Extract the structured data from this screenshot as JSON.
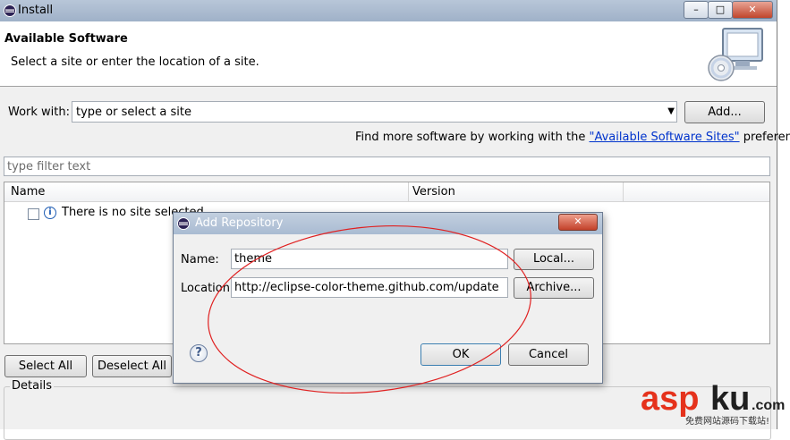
{
  "window": {
    "title": "Install",
    "controls": [
      "–",
      "□",
      "✕"
    ]
  },
  "header": {
    "title": "Available Software",
    "subtitle": "Select a site or enter the location of a site."
  },
  "work_with": {
    "label": "Work with:",
    "value": "type or select a site",
    "add_button": "Add..."
  },
  "find_more": {
    "prefix": "Find more software by working with the ",
    "link": "\"Available Software Sites\"",
    "suffix": " preferences."
  },
  "filter": {
    "placeholder": "type filter text"
  },
  "table": {
    "columns": [
      "Name",
      "Version"
    ],
    "rows": [
      {
        "text": "There is no site selected."
      }
    ]
  },
  "buttons": {
    "select_all": "Select All",
    "deselect_all": "Deselect All"
  },
  "details": {
    "label": "Details"
  },
  "dialog": {
    "title": "Add Repository",
    "name_label": "Name:",
    "name_value": "theme",
    "location_label": "Location:",
    "location_value": "http://eclipse-color-theme.github.com/update",
    "local_button": "Local...",
    "archive_button": "Archive...",
    "ok_button": "OK",
    "cancel_button": "Cancel",
    "help_symbol": "?"
  },
  "annotation": {
    "color": "#e02020"
  },
  "watermark": {
    "brand": "aspku",
    "suffix": ".com",
    "caption": "免费网站源码下载站!"
  }
}
